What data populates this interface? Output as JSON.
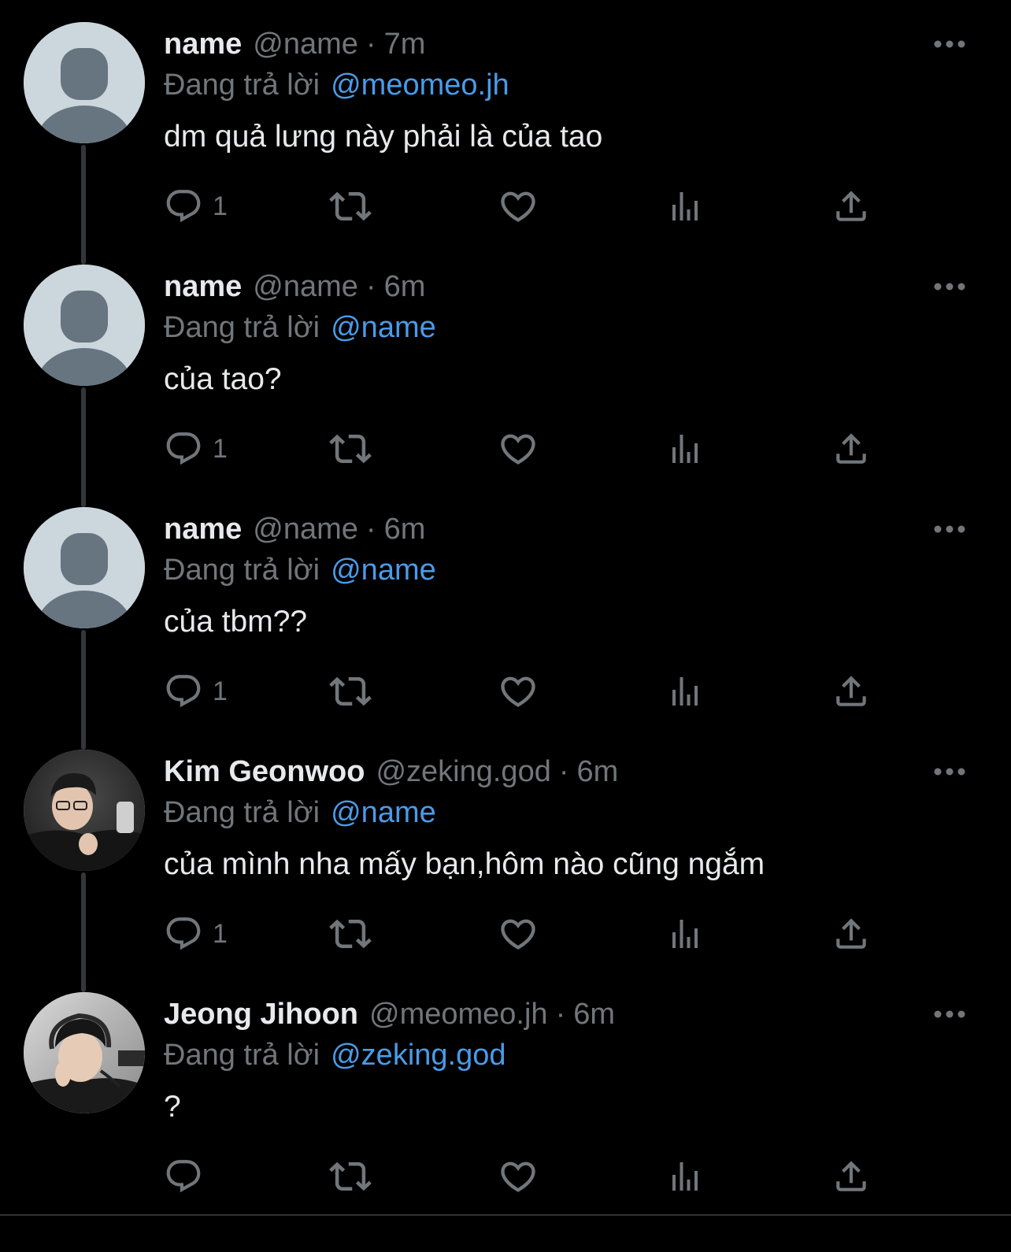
{
  "reply_prefix": "Đang trả lời",
  "colors": {
    "background": "#000000",
    "text": "#e7e9ea",
    "secondary": "#71767b",
    "mention": "#4a9be8",
    "thread_line": "#333639"
  },
  "icons": [
    "reply-icon",
    "retweet-icon",
    "like-icon",
    "views-icon",
    "share-icon",
    "more-icon"
  ],
  "tweets": [
    {
      "display_name": "name",
      "handle": "@name",
      "time": "7m",
      "reply_to": "@meomeo.jh",
      "text": "dm quả lưng này phải là của tao",
      "reply_count": "1",
      "avatar": "default"
    },
    {
      "display_name": "name",
      "handle": "@name",
      "time": "6m",
      "reply_to": "@name",
      "text": "của tao?",
      "reply_count": "1",
      "avatar": "default"
    },
    {
      "display_name": "name",
      "handle": "@name",
      "time": "6m",
      "reply_to": "@name",
      "text": "của tbm??",
      "reply_count": "1",
      "avatar": "default"
    },
    {
      "display_name": "Kim Geonwoo",
      "handle": "@zeking.god",
      "time": "6m",
      "reply_to": "@name",
      "text": "của mình nha mấy bạn,hôm nào cũng ngắm",
      "reply_count": "1",
      "avatar": "photo"
    },
    {
      "display_name": "Jeong Jihoon",
      "handle": "@meomeo.jh",
      "time": "6m",
      "reply_to": "@zeking.god",
      "text": "?",
      "reply_count": "",
      "avatar": "photo"
    }
  ]
}
